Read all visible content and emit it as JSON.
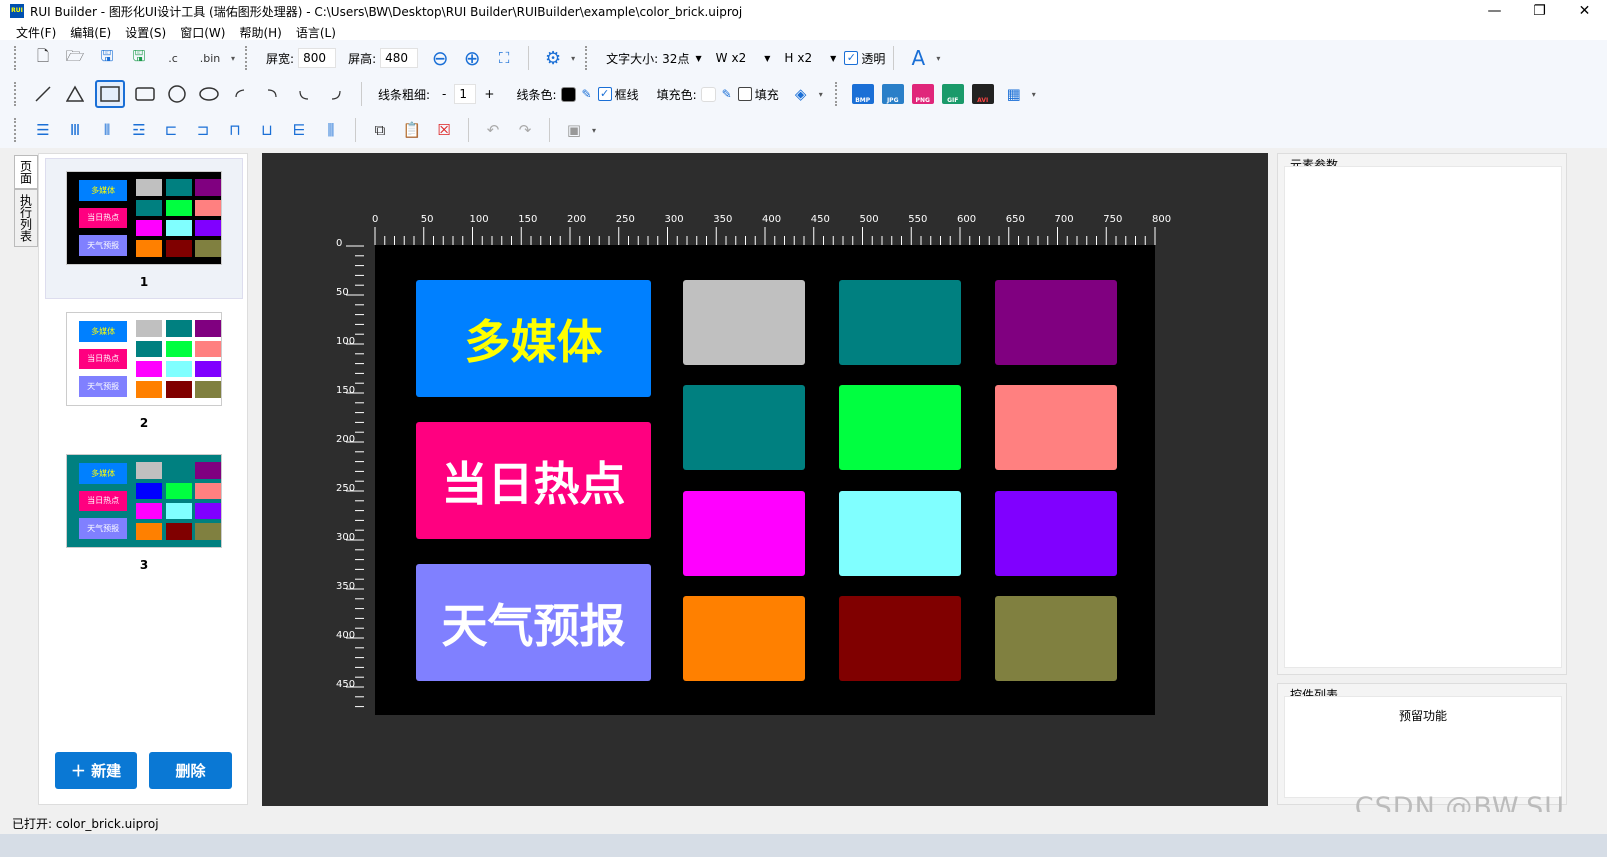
{
  "window": {
    "title": "RUI Builder - 图形化UI设计工具 (瑞佑图形处理器) - C:\\Users\\BW\\Desktop\\RUI Builder\\RUIBuilder\\example\\color_brick.uiproj",
    "app_icon_text": "RUI"
  },
  "menu": [
    "文件(F)",
    "编辑(E)",
    "设置(S)",
    "窗口(W)",
    "帮助(H)",
    "语言(L)"
  ],
  "toolbar1": {
    "export_c": ".c",
    "export_bin": ".bin",
    "screen_width_label": "屏宽:",
    "screen_width": "800",
    "screen_height_label": "屏高:",
    "screen_height": "480",
    "font_size_label": "文字大小:",
    "font_size": "32点",
    "w_label": "W",
    "w_value": "x2",
    "h_label": "H",
    "h_value": "x2",
    "transparent_label": "透明",
    "font_button": "A"
  },
  "toolbar2": {
    "line_width_label": "线条粗细:",
    "line_width_minus": "-",
    "line_width": "1",
    "line_width_plus": "+",
    "line_color_label": "线条色:",
    "frame_label": "框线",
    "fill_color_label": "填充色:",
    "fill_label": "填充",
    "formats": [
      "BMP",
      "JPG",
      "PNG",
      "GIF",
      "AVI"
    ]
  },
  "left_tabs": [
    "页面",
    "执行列表"
  ],
  "pages": [
    {
      "number": "1",
      "bg": "#000000",
      "selected": true
    },
    {
      "number": "2",
      "bg": "#ffffff",
      "selected": false
    },
    {
      "number": "3",
      "bg": "#008080",
      "selected": false
    }
  ],
  "thumb_labels": [
    "多媒体",
    "当日热点",
    "天气预报"
  ],
  "buttons": {
    "new": "＋ 新建",
    "delete": "删除"
  },
  "canvas": {
    "ruler_h": [
      "0",
      "50",
      "100",
      "150",
      "200",
      "250",
      "300",
      "350",
      "400",
      "450",
      "500",
      "550",
      "600",
      "650",
      "700",
      "750",
      "800"
    ],
    "ruler_v": [
      "0",
      "50",
      "100",
      "150",
      "200",
      "250",
      "300",
      "350",
      "400",
      "450"
    ],
    "screen_bg": "#000000",
    "big_buttons": [
      {
        "label": "多媒体",
        "bg": "#0080ff",
        "color": "#ffff00"
      },
      {
        "label": "当日热点",
        "bg": "#ff0080",
        "color": "#ffffff"
      },
      {
        "label": "天气预报",
        "bg": "#8080ff",
        "color": "#ffffff"
      }
    ],
    "bricks": [
      [
        "#c0c0c0",
        "#008080",
        "#800080"
      ],
      [
        "#008080",
        "#00ff40",
        "#ff8080"
      ],
      [
        "#ff00ff",
        "#80ffff",
        "#8000ff"
      ],
      [
        "#ff8000",
        "#800000",
        "#808040"
      ]
    ]
  },
  "right_panel": {
    "params_title": "元素参数",
    "controls_title": "控件列表",
    "controls_note": "预留功能"
  },
  "status": "已打开: color_brick.uiproj",
  "watermark": "CSDN @BW.SU"
}
